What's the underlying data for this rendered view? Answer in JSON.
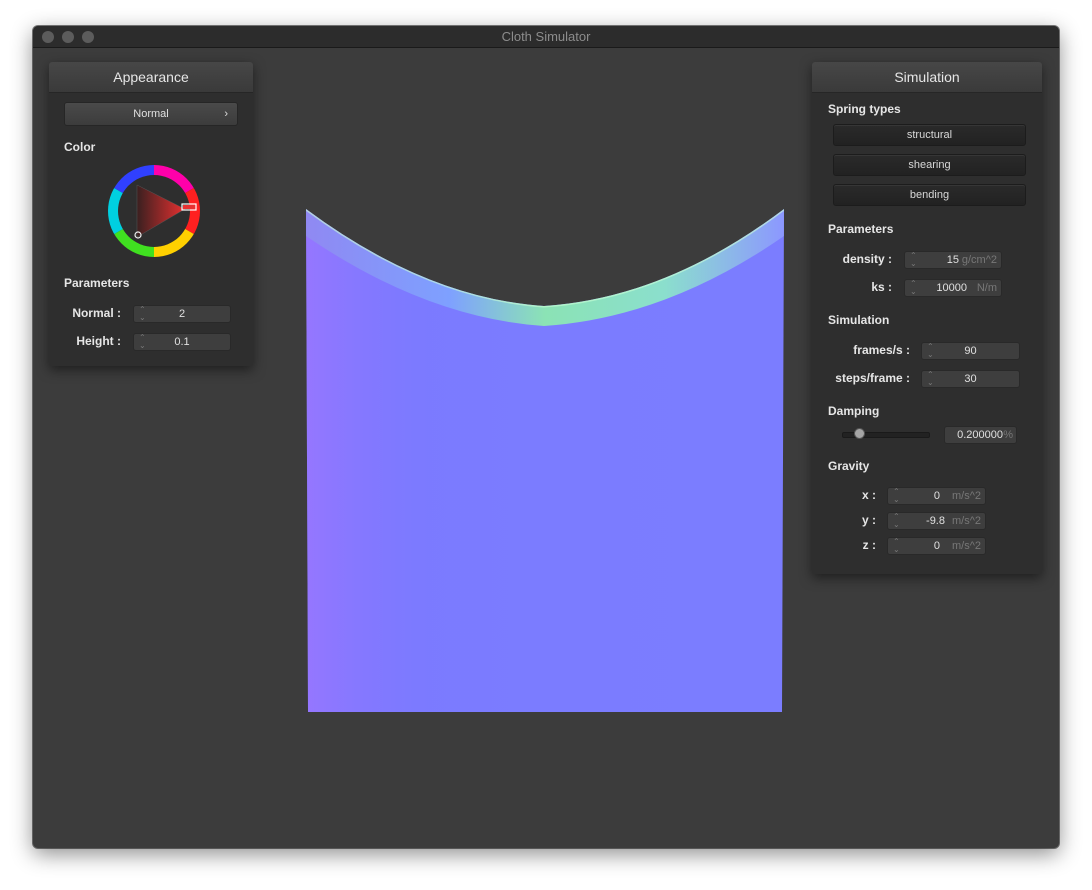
{
  "window": {
    "title": "Cloth Simulator"
  },
  "appearance": {
    "header": "Appearance",
    "shader": "Normal",
    "color_label": "Color",
    "parameters_label": "Parameters",
    "normal_label": "Normal :",
    "normal_value": "2",
    "height_label": "Height :",
    "height_value": "0.1",
    "selected_color": "#e83030"
  },
  "simulation": {
    "header": "Simulation",
    "spring_types_label": "Spring types",
    "spring_types": [
      "structural",
      "shearing",
      "bending"
    ],
    "parameters_label": "Parameters",
    "density_label": "density :",
    "density_value": "15",
    "density_unit": "g/cm^2",
    "ks_label": "ks :",
    "ks_value": "10000",
    "ks_unit": "N/m",
    "simulation_label": "Simulation",
    "fps_label": "frames/s :",
    "fps_value": "90",
    "steps_label": "steps/frame :",
    "steps_value": "30",
    "damping_label": "Damping",
    "damping_value": "0.200000",
    "damping_unit": "%",
    "damping_fraction": 0.2,
    "gravity_label": "Gravity",
    "gx_label": "x :",
    "gx_value": "0",
    "gy_label": "y :",
    "gy_value": "-9.8",
    "gz_label": "z :",
    "gz_value": "0",
    "gravity_unit": "m/s^2"
  }
}
